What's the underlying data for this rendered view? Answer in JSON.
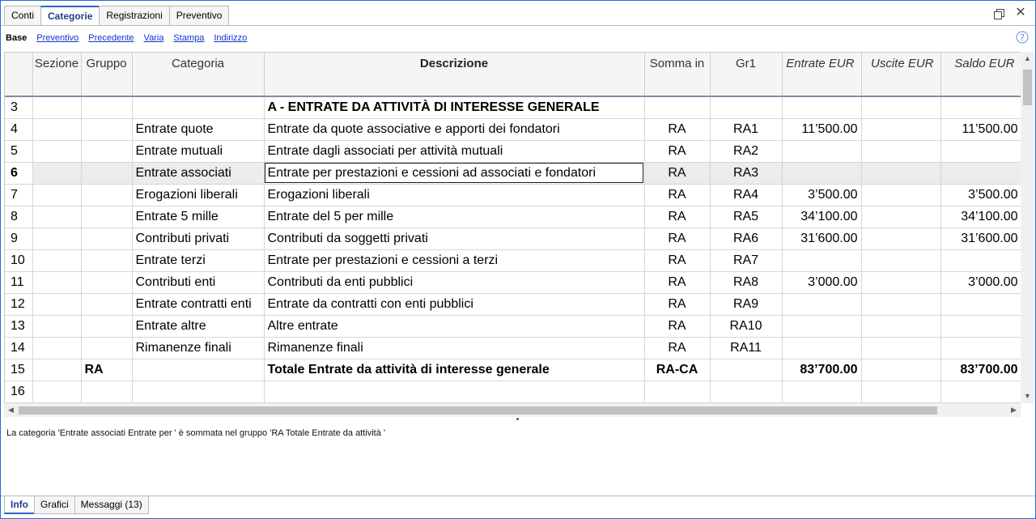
{
  "tabs": [
    "Conti",
    "Categorie",
    "Registrazioni",
    "Preventivo"
  ],
  "active_tab": "Categorie",
  "views": [
    "Base",
    "Preventivo",
    "Precedente",
    "Varia",
    "Stampa",
    "Indirizzo"
  ],
  "active_view": "Base",
  "table": {
    "columns": [
      "Sezione",
      "Gruppo",
      "Categoria",
      "Descrizione",
      "Somma in",
      "Gr1",
      "Entrate EUR",
      "Uscite EUR",
      "Saldo EUR"
    ],
    "rows": [
      {
        "n": "3",
        "sezione": "",
        "gruppo": "",
        "categoria": "",
        "descrizione": "A - ENTRATE DA ATTIVITÀ DI INTERESSE GENERALE",
        "somma": "",
        "gr1": "",
        "entrate": "",
        "uscite": "",
        "saldo": ""
      },
      {
        "n": "4",
        "sezione": "",
        "gruppo": "",
        "categoria": "Entrate quote",
        "descrizione": "Entrate da quote associative e apporti dei fondatori",
        "somma": "RA",
        "gr1": "RA1",
        "entrate": "11’500.00",
        "uscite": "",
        "saldo": "11’500.00"
      },
      {
        "n": "5",
        "sezione": "",
        "gruppo": "",
        "categoria": "Entrate mutuali",
        "descrizione": "Entrate dagli associati per attività mutuali",
        "somma": "RA",
        "gr1": "RA2",
        "entrate": "",
        "uscite": "",
        "saldo": ""
      },
      {
        "n": "6",
        "sezione": "",
        "gruppo": "",
        "categoria": "Entrate associati",
        "descrizione": "Entrate per prestazioni e cessioni ad associati e fondatori",
        "somma": "RA",
        "gr1": "RA3",
        "entrate": "",
        "uscite": "",
        "saldo": ""
      },
      {
        "n": "7",
        "sezione": "",
        "gruppo": "",
        "categoria": "Erogazioni liberali",
        "descrizione": "Erogazioni liberali",
        "somma": "RA",
        "gr1": "RA4",
        "entrate": "3’500.00",
        "uscite": "",
        "saldo": "3’500.00"
      },
      {
        "n": "8",
        "sezione": "",
        "gruppo": "",
        "categoria": "Entrate 5 mille",
        "descrizione": "Entrate del 5 per mille",
        "somma": "RA",
        "gr1": "RA5",
        "entrate": "34’100.00",
        "uscite": "",
        "saldo": "34’100.00"
      },
      {
        "n": "9",
        "sezione": "",
        "gruppo": "",
        "categoria": "Contributi privati",
        "descrizione": "Contributi da soggetti privati",
        "somma": "RA",
        "gr1": "RA6",
        "entrate": "31’600.00",
        "uscite": "",
        "saldo": "31’600.00"
      },
      {
        "n": "10",
        "sezione": "",
        "gruppo": "",
        "categoria": "Entrate terzi",
        "descrizione": "Entrate per prestazioni e cessioni a terzi",
        "somma": "RA",
        "gr1": "RA7",
        "entrate": "",
        "uscite": "",
        "saldo": ""
      },
      {
        "n": "11",
        "sezione": "",
        "gruppo": "",
        "categoria": "Contributi enti",
        "descrizione": "Contributi da enti pubblici",
        "somma": "RA",
        "gr1": "RA8",
        "entrate": "3’000.00",
        "uscite": "",
        "saldo": "3’000.00"
      },
      {
        "n": "12",
        "sezione": "",
        "gruppo": "",
        "categoria": "Entrate contratti enti",
        "descrizione": "Entrate da contratti con enti pubblici",
        "somma": "RA",
        "gr1": "RA9",
        "entrate": "",
        "uscite": "",
        "saldo": ""
      },
      {
        "n": "13",
        "sezione": "",
        "gruppo": "",
        "categoria": "Entrate altre",
        "descrizione": "Altre entrate",
        "somma": "RA",
        "gr1": "RA10",
        "entrate": "",
        "uscite": "",
        "saldo": ""
      },
      {
        "n": "14",
        "sezione": "",
        "gruppo": "",
        "categoria": "Rimanenze finali",
        "descrizione": "Rimanenze finali",
        "somma": "RA",
        "gr1": "RA11",
        "entrate": "",
        "uscite": "",
        "saldo": ""
      },
      {
        "n": "15",
        "sezione": "",
        "gruppo": "RA",
        "categoria": "",
        "descrizione": "Totale Entrate da attività di interesse generale",
        "somma": "RA-CA",
        "gr1": "",
        "entrate": "83’700.00",
        "uscite": "",
        "saldo": "83’700.00"
      },
      {
        "n": "16",
        "sezione": "",
        "gruppo": "",
        "categoria": "",
        "descrizione": "",
        "somma": "",
        "gr1": "",
        "entrate": "",
        "uscite": "",
        "saldo": ""
      }
    ]
  },
  "info_message": "La categoria 'Entrate associati Entrate per ' è sommata nel gruppo 'RA Totale Entrate da attività '",
  "bottom_tabs": [
    "Info",
    "Grafici",
    "Messaggi (13)"
  ],
  "active_bottom_tab": "Info"
}
